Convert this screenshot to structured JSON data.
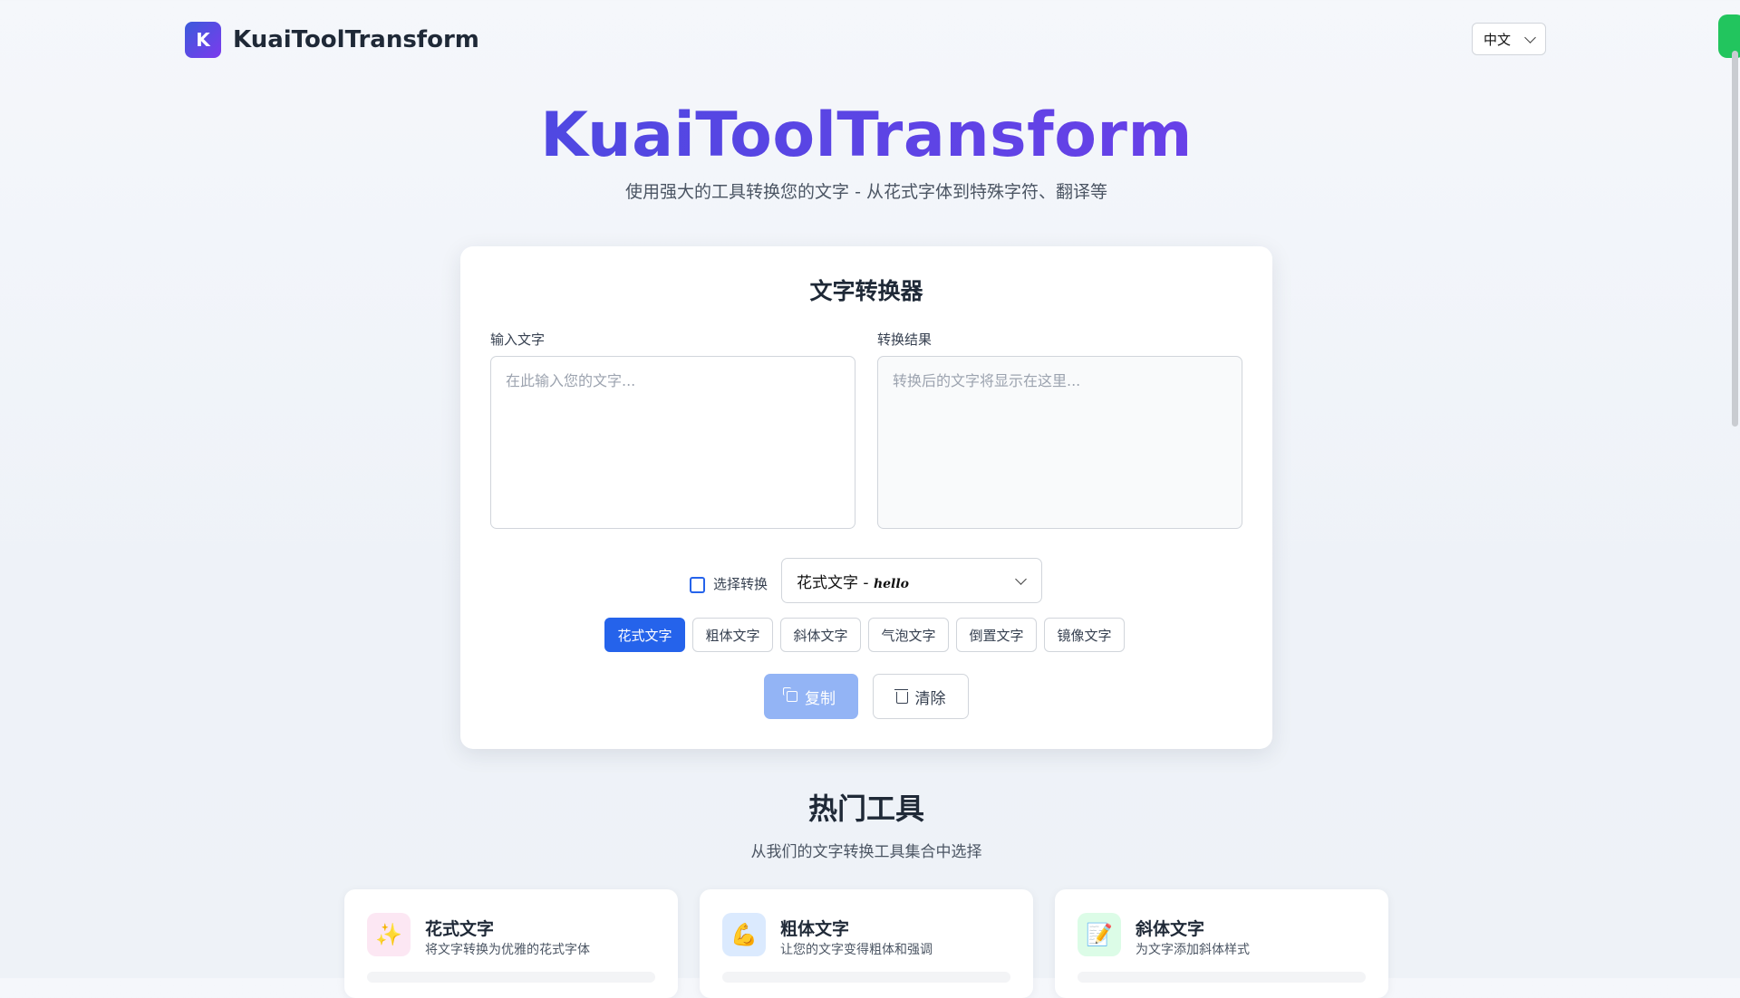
{
  "header": {
    "logo_letter": "K",
    "brand": "KuaiToolTransform",
    "language": "中文"
  },
  "hero": {
    "title": "KuaiToolTransform",
    "subtitle": "使用强大的工具转换您的文字 - 从花式字体到特殊字符、翻译等"
  },
  "converter": {
    "title": "文字转换器",
    "input_label": "输入文字",
    "input_placeholder": "在此输入您的文字...",
    "output_label": "转换结果",
    "output_placeholder": "转换后的文字将显示在这里...",
    "select_label": "选择转换",
    "selected_transform": "花式文字 - ",
    "selected_sample": "hello",
    "chips": [
      {
        "label": "花式文字",
        "active": true
      },
      {
        "label": "粗体文字",
        "active": false
      },
      {
        "label": "斜体文字",
        "active": false
      },
      {
        "label": "气泡文字",
        "active": false
      },
      {
        "label": "倒置文字",
        "active": false
      },
      {
        "label": "镜像文字",
        "active": false
      }
    ],
    "copy_label": "复制",
    "clear_label": "清除"
  },
  "popular": {
    "title": "热门工具",
    "subtitle": "从我们的文字转换工具集合中选择",
    "tools": [
      {
        "icon": "sparkles-icon",
        "glyph": "✨",
        "bg": "#fce7f3",
        "name": "花式文字",
        "desc": "将文字转换为优雅的花式字体"
      },
      {
        "icon": "flexed-biceps-icon",
        "glyph": "💪",
        "bg": "#dbeafe",
        "name": "粗体文字",
        "desc": "让您的文字变得粗体和强调"
      },
      {
        "icon": "memo-icon",
        "glyph": "📝",
        "bg": "#dcfce7",
        "name": "斜体文字",
        "desc": "为文字添加斜体样式"
      }
    ]
  },
  "colors": {
    "accent": "#2563eb",
    "brand_gradient_start": "#3b4fdc",
    "brand_gradient_end": "#7c3aed"
  }
}
